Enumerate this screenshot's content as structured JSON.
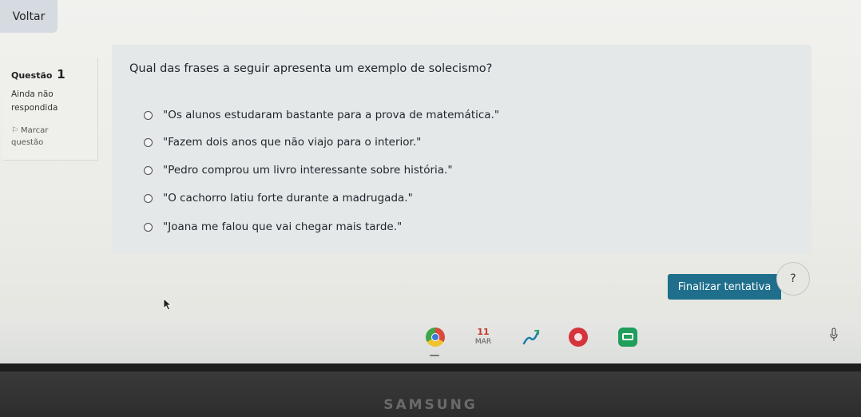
{
  "nav": {
    "back_label": "Voltar"
  },
  "question_info": {
    "label": "Questão",
    "number": "1",
    "status_line1": "Ainda não",
    "status_line2": "respondida",
    "flag_line1": "Marcar",
    "flag_line2": "questão"
  },
  "question": {
    "text": "Qual das frases a seguir apresenta um exemplo de solecismo?",
    "options": [
      "\"Os alunos estudaram bastante para a prova de matemática.\"",
      "\"Fazem dois anos que não viajo para o interior.\"",
      "\"Pedro comprou um livro interessante sobre história.\"",
      "\"O cachorro latiu forte durante a madrugada.\"",
      "\"Joana me falou que vai chegar mais tarde.\""
    ]
  },
  "actions": {
    "finish_label": "Finalizar tentativa",
    "help_label": "?"
  },
  "taskbar": {
    "calendar_day": "11",
    "calendar_month": "MAR",
    "icons": [
      "chrome-icon",
      "calendar-icon",
      "pen-icon",
      "red-app-icon",
      "classroom-icon",
      "microphone-icon"
    ]
  },
  "device": {
    "brand": "SAMSUNG"
  },
  "colors": {
    "accent": "#1f6f8c",
    "panel": "#e5e8e9",
    "back_button": "#d5dbe0"
  }
}
